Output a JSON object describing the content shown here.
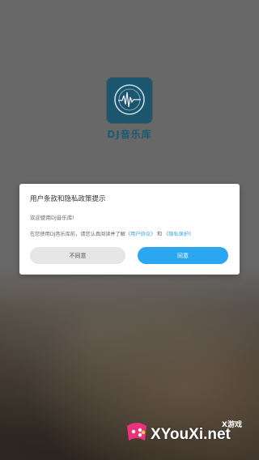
{
  "splash": {
    "app_name": "DJ音乐库"
  },
  "dialog": {
    "title": "用户条款和隐私政策提示",
    "welcome": "欢迎使用DJ音乐库!",
    "body_prefix": "在您使用DJ音乐库前，请您认真阅读并了解",
    "user_agreement_link": "《用户协议》",
    "body_and": " 和 ",
    "privacy_link": "《隐私保护》",
    "disagree_label": "不同意",
    "agree_label": "同意"
  },
  "watermark": {
    "cn_text": "X游戏",
    "en_text": "XYouXi.net"
  },
  "colors": {
    "accent": "#2ba6f0",
    "link": "#3aa0e8",
    "brand": "#1f5f7a"
  }
}
